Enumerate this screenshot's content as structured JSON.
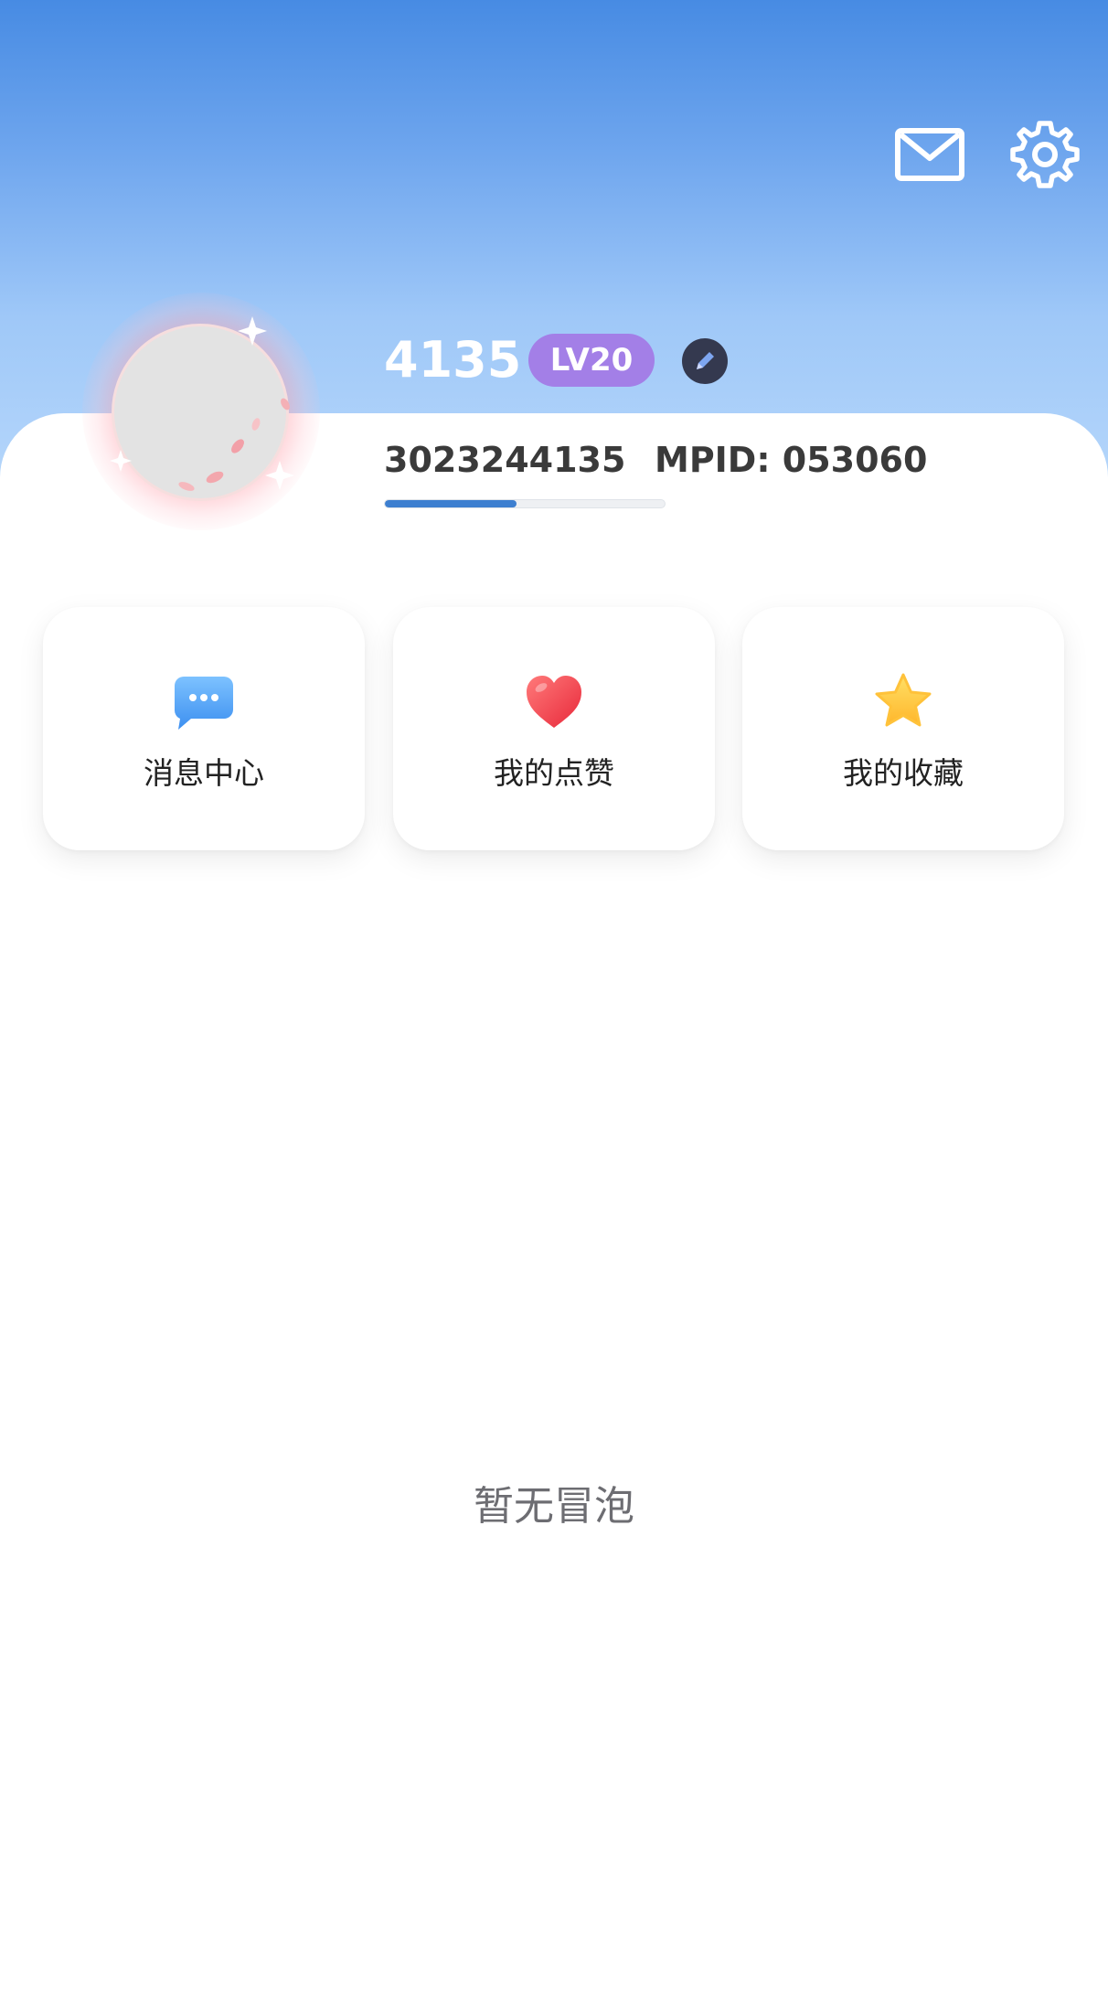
{
  "header": {
    "mail_icon": "mail-icon",
    "settings_icon": "gear-icon"
  },
  "profile": {
    "username": "4135",
    "level": "LV20",
    "user_id": "3023244135",
    "mpid": "MPID: 053060",
    "level_progress": 0.47,
    "edit_icon": "pencil-icon"
  },
  "quick_actions": [
    {
      "label": "消息中心",
      "icon": "chat-bubble-icon",
      "color": "#4a9ff5"
    },
    {
      "label": "我的点赞",
      "icon": "heart-icon",
      "color": "#f4454f"
    },
    {
      "label": "我的收藏",
      "icon": "star-icon",
      "color": "#ffc93a"
    }
  ],
  "empty_state": {
    "text": "暂无冒泡"
  },
  "colors": {
    "header_top": "#478be3",
    "header_bottom": "#b8d8fb",
    "level_badge": "#a37fe7",
    "progress": "#3d7fd0"
  }
}
